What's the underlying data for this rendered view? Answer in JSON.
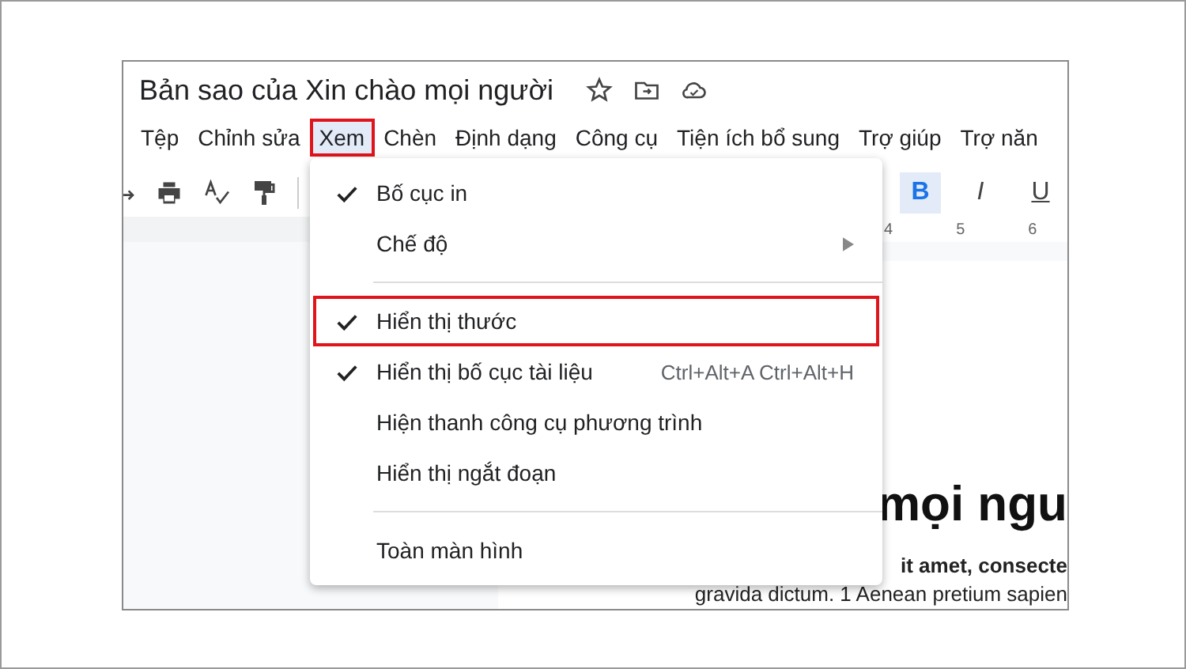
{
  "document_title": "Bản sao của Xin chào mọi người",
  "menu_bar": [
    {
      "label": "Tệp",
      "selected": false,
      "annotated": false
    },
    {
      "label": "Chỉnh sửa",
      "selected": false,
      "annotated": false
    },
    {
      "label": "Xem",
      "selected": true,
      "annotated": true
    },
    {
      "label": "Chèn",
      "selected": false,
      "annotated": false
    },
    {
      "label": "Định dạng",
      "selected": false,
      "annotated": false
    },
    {
      "label": "Công cụ",
      "selected": false,
      "annotated": false
    },
    {
      "label": "Tiện ích bổ sung",
      "selected": false,
      "annotated": false
    },
    {
      "label": "Trợ giúp",
      "selected": false,
      "annotated": false
    },
    {
      "label": "Trợ năn",
      "selected": false,
      "annotated": false
    }
  ],
  "format_buttons": [
    {
      "label": "B",
      "kind": "bold",
      "selected": true
    },
    {
      "label": "I",
      "kind": "italic",
      "selected": false
    },
    {
      "label": "U",
      "kind": "underline",
      "selected": false
    }
  ],
  "ruler": [
    "4",
    "5",
    "6"
  ],
  "view_menu": [
    {
      "kind": "item",
      "label": "Bố cục in",
      "checked": true,
      "submenu": false,
      "annotated": false
    },
    {
      "kind": "item",
      "label": "Chế độ",
      "checked": false,
      "submenu": true,
      "annotated": false
    },
    {
      "kind": "separator"
    },
    {
      "kind": "item",
      "label": "Hiển thị thước",
      "checked": true,
      "submenu": false,
      "annotated": true
    },
    {
      "kind": "item",
      "label": "Hiển thị bố cục tài liệu",
      "checked": true,
      "submenu": false,
      "annotated": false,
      "shortcut": "Ctrl+Alt+A Ctrl+Alt+H"
    },
    {
      "kind": "item",
      "label": "Hiện thanh công cụ phương trình",
      "checked": false,
      "submenu": false,
      "annotated": false
    },
    {
      "kind": "item",
      "label": "Hiển thị ngắt đoạn",
      "checked": false,
      "submenu": false,
      "annotated": false
    },
    {
      "kind": "separator"
    },
    {
      "kind": "item",
      "label": "Toàn màn hình",
      "checked": false,
      "submenu": false,
      "annotated": false
    }
  ],
  "document": {
    "heading": "mọi ngu",
    "lines": [
      "it amet, consecte",
      "gravida dictum. 1 Aenean pretium sapien"
    ]
  }
}
